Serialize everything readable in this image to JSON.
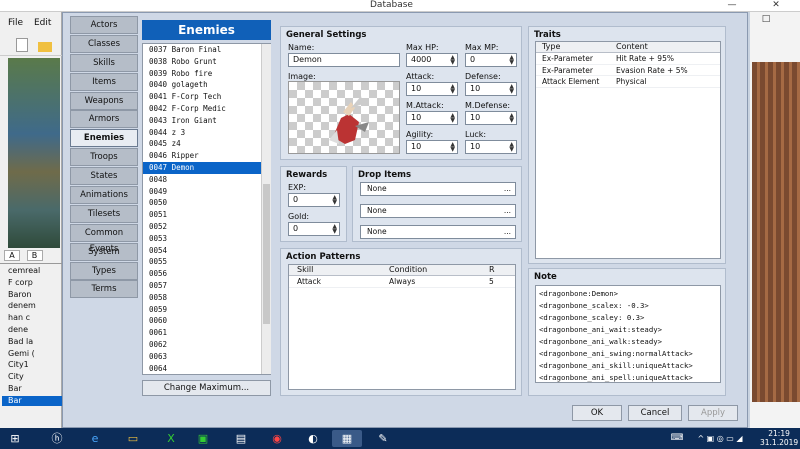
{
  "window": {
    "title": "Database",
    "minimize": "—",
    "close": "✕",
    "restore": "□"
  },
  "bg_app": {
    "menu": [
      "File",
      "Edit"
    ],
    "tabs": [
      "A",
      "B"
    ],
    "tree": [
      "cemreal",
      "F corp",
      "Baron",
      "denem",
      "han c",
      "dene",
      "Bad la",
      "Gemi (",
      "City1",
      "City",
      "Bar",
      "Bar"
    ]
  },
  "categories": [
    "Actors",
    "Classes",
    "Skills",
    "Items",
    "Weapons",
    "Armors",
    "Enemies",
    "Troops",
    "States",
    "Animations",
    "Tilesets",
    "Common Events",
    "System",
    "Types",
    "Terms"
  ],
  "active_category": "Enemies",
  "list": {
    "title": "Enemies",
    "items": [
      "0037 Baron Final",
      "0038 Robo Grunt",
      "0039 Robo fire",
      "0040 golageth",
      "0041 F-Corp Tech",
      "0042 F-Corp Medic",
      "0043 Iron Giant",
      "0044 z 3",
      "0045 z4",
      "0046 Ripper",
      "0047 Demon",
      "0048",
      "0049",
      "0050",
      "0051",
      "0052",
      "0053",
      "0054",
      "0055",
      "0056",
      "0057",
      "0058",
      "0059",
      "0060",
      "0061",
      "0062",
      "0063",
      "0064"
    ],
    "selected": "0047 Demon",
    "change_max": "Change Maximum..."
  },
  "general": {
    "title": "General Settings",
    "name_label": "Name:",
    "name": "Demon",
    "image_label": "Image:",
    "max_hp_label": "Max HP:",
    "max_hp": "4000",
    "max_mp_label": "Max MP:",
    "max_mp": "0",
    "attack_label": "Attack:",
    "attack": "10",
    "defense_label": "Defense:",
    "defense": "10",
    "mattack_label": "M.Attack:",
    "mattack": "10",
    "mdefense_label": "M.Defense:",
    "mdefense": "10",
    "agility_label": "Agility:",
    "agility": "10",
    "luck_label": "Luck:",
    "luck": "10"
  },
  "rewards": {
    "title": "Rewards",
    "exp_label": "EXP:",
    "exp": "0",
    "gold_label": "Gold:",
    "gold": "0"
  },
  "drops": {
    "title": "Drop Items",
    "items": [
      "None",
      "None",
      "None"
    ],
    "dots": "..."
  },
  "actions": {
    "title": "Action Patterns",
    "headers": [
      "Skill",
      "Condition",
      "R"
    ],
    "rows": [
      [
        "Attack",
        "Always",
        "5"
      ]
    ]
  },
  "traits": {
    "title": "Traits",
    "headers": [
      "Type",
      "Content"
    ],
    "rows": [
      [
        "Ex-Parameter",
        "Hit Rate + 95%"
      ],
      [
        "Ex-Parameter",
        "Evasion Rate + 5%"
      ],
      [
        "Attack Element",
        "Physical"
      ]
    ]
  },
  "note": {
    "title": "Note",
    "lines": [
      "<dragonbone:Demon>",
      "<dragonbone_scalex: -0.3>",
      "<dragonbone_scaley: 0.3>",
      "<dragonbone_ani_wait:steady>",
      "<dragonbone_ani_walk:steady>",
      "<dragonbone_ani_swing:normalAttack>",
      "<dragonbone_ani_skill:uniqueAttack>",
      "<dragonbone_ani_spell:uniqueAttack>"
    ]
  },
  "buttons": {
    "ok": "OK",
    "cancel": "Cancel",
    "apply": "Apply"
  },
  "taskbar": {
    "time": "21:19",
    "date": "31.1.2019"
  }
}
